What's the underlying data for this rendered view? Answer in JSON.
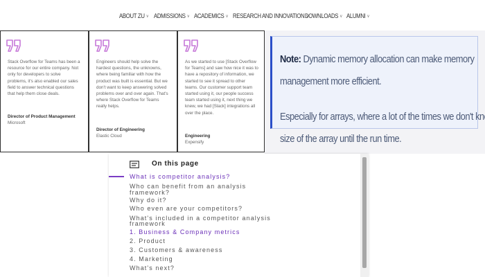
{
  "nav": {
    "items": [
      {
        "label": "ABOUT ZU"
      },
      {
        "label": "ADMISSIONS"
      },
      {
        "label": "ACADEMICS"
      },
      {
        "label": "RESEARCH AND INNOVATION"
      },
      {
        "label": "DOWNLOADS"
      },
      {
        "label": "ALUMNI"
      }
    ],
    "chevron": "˅"
  },
  "testimonials": [
    {
      "quote": [
        "Stack Overflow for Teams has been a",
        "resource for our entire company. Not",
        "only for developers to solve",
        "problems, it's also enabled our sales",
        "field to answer technical questions",
        "that help them close deals."
      ],
      "role": "Director of Product Management",
      "company": "Microsoft"
    },
    {
      "quote": [
        "Engineers should help solve the",
        "hardest questions, the unknowns,",
        "where being familiar with how the",
        "product was built is essential. But we",
        "don't want to keep answering solved",
        "problems over and over again. That's",
        "where Stack Overflow for Teams",
        "really helps."
      ],
      "role": "Director of Engineering",
      "company": "Elastic Cloud"
    },
    {
      "quote": [
        "As we started to use [Stack Overflow",
        "for Teams] and saw how nice it was to",
        "have a repository of information, we",
        "started to see it spread to other",
        "teams. Our customer support team",
        "started using it, our people success",
        "team started using it, next thing we",
        "knew, we had [Slack] integrations all",
        "over the place."
      ],
      "role": "Engineering",
      "company": "Expensify"
    }
  ],
  "note": {
    "label": "Note:",
    "line1": " Dynamic memory allocation can make memory",
    "line2": "management more efficient.",
    "line3": "Especially for arrays, where a lot of the times we don't know the",
    "line4": "size of the array until the run time."
  },
  "toc": {
    "title": "On this page",
    "items": [
      {
        "label": "What is competitor analysis?",
        "state": "active"
      },
      {
        "label": "Who can benefit from an analysis",
        "state": "normal"
      },
      {
        "label": "framework?",
        "state": "normal"
      },
      {
        "label": "Why do it?",
        "state": "normal"
      },
      {
        "label": "Who even are your competitors?",
        "state": "normal"
      },
      {
        "label": "What's included in a competitor analysis",
        "state": "normal"
      },
      {
        "label": "framework",
        "state": "normal"
      },
      {
        "label": "1. Business & Company metrics",
        "state": "sub"
      },
      {
        "label": "2. Product",
        "state": "normal"
      },
      {
        "label": "3. Customers & awareness",
        "state": "normal"
      },
      {
        "label": "4. Marketing",
        "state": "normal"
      },
      {
        "label": "What's next?",
        "state": "normal"
      }
    ]
  },
  "colors": {
    "accent_purple": "#7a3cc4",
    "quote_icon": "#c678d8",
    "note_border": "#2b4fc9"
  }
}
